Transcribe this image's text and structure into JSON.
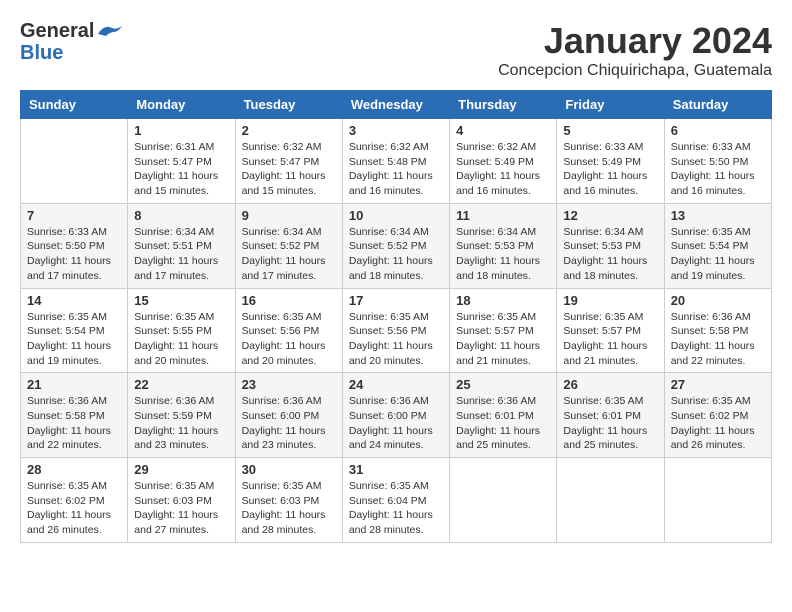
{
  "header": {
    "logo_line1": "General",
    "logo_line2": "Blue",
    "month_title": "January 2024",
    "location": "Concepcion Chiquirichapa, Guatemala"
  },
  "days_of_week": [
    "Sunday",
    "Monday",
    "Tuesday",
    "Wednesday",
    "Thursday",
    "Friday",
    "Saturday"
  ],
  "weeks": [
    [
      {
        "day": "",
        "sunrise": "",
        "sunset": "",
        "daylight": ""
      },
      {
        "day": "1",
        "sunrise": "Sunrise: 6:31 AM",
        "sunset": "Sunset: 5:47 PM",
        "daylight": "Daylight: 11 hours and 15 minutes."
      },
      {
        "day": "2",
        "sunrise": "Sunrise: 6:32 AM",
        "sunset": "Sunset: 5:47 PM",
        "daylight": "Daylight: 11 hours and 15 minutes."
      },
      {
        "day": "3",
        "sunrise": "Sunrise: 6:32 AM",
        "sunset": "Sunset: 5:48 PM",
        "daylight": "Daylight: 11 hours and 16 minutes."
      },
      {
        "day": "4",
        "sunrise": "Sunrise: 6:32 AM",
        "sunset": "Sunset: 5:49 PM",
        "daylight": "Daylight: 11 hours and 16 minutes."
      },
      {
        "day": "5",
        "sunrise": "Sunrise: 6:33 AM",
        "sunset": "Sunset: 5:49 PM",
        "daylight": "Daylight: 11 hours and 16 minutes."
      },
      {
        "day": "6",
        "sunrise": "Sunrise: 6:33 AM",
        "sunset": "Sunset: 5:50 PM",
        "daylight": "Daylight: 11 hours and 16 minutes."
      }
    ],
    [
      {
        "day": "7",
        "sunrise": "Sunrise: 6:33 AM",
        "sunset": "Sunset: 5:50 PM",
        "daylight": "Daylight: 11 hours and 17 minutes."
      },
      {
        "day": "8",
        "sunrise": "Sunrise: 6:34 AM",
        "sunset": "Sunset: 5:51 PM",
        "daylight": "Daylight: 11 hours and 17 minutes."
      },
      {
        "day": "9",
        "sunrise": "Sunrise: 6:34 AM",
        "sunset": "Sunset: 5:52 PM",
        "daylight": "Daylight: 11 hours and 17 minutes."
      },
      {
        "day": "10",
        "sunrise": "Sunrise: 6:34 AM",
        "sunset": "Sunset: 5:52 PM",
        "daylight": "Daylight: 11 hours and 18 minutes."
      },
      {
        "day": "11",
        "sunrise": "Sunrise: 6:34 AM",
        "sunset": "Sunset: 5:53 PM",
        "daylight": "Daylight: 11 hours and 18 minutes."
      },
      {
        "day": "12",
        "sunrise": "Sunrise: 6:34 AM",
        "sunset": "Sunset: 5:53 PM",
        "daylight": "Daylight: 11 hours and 18 minutes."
      },
      {
        "day": "13",
        "sunrise": "Sunrise: 6:35 AM",
        "sunset": "Sunset: 5:54 PM",
        "daylight": "Daylight: 11 hours and 19 minutes."
      }
    ],
    [
      {
        "day": "14",
        "sunrise": "Sunrise: 6:35 AM",
        "sunset": "Sunset: 5:54 PM",
        "daylight": "Daylight: 11 hours and 19 minutes."
      },
      {
        "day": "15",
        "sunrise": "Sunrise: 6:35 AM",
        "sunset": "Sunset: 5:55 PM",
        "daylight": "Daylight: 11 hours and 20 minutes."
      },
      {
        "day": "16",
        "sunrise": "Sunrise: 6:35 AM",
        "sunset": "Sunset: 5:56 PM",
        "daylight": "Daylight: 11 hours and 20 minutes."
      },
      {
        "day": "17",
        "sunrise": "Sunrise: 6:35 AM",
        "sunset": "Sunset: 5:56 PM",
        "daylight": "Daylight: 11 hours and 20 minutes."
      },
      {
        "day": "18",
        "sunrise": "Sunrise: 6:35 AM",
        "sunset": "Sunset: 5:57 PM",
        "daylight": "Daylight: 11 hours and 21 minutes."
      },
      {
        "day": "19",
        "sunrise": "Sunrise: 6:35 AM",
        "sunset": "Sunset: 5:57 PM",
        "daylight": "Daylight: 11 hours and 21 minutes."
      },
      {
        "day": "20",
        "sunrise": "Sunrise: 6:36 AM",
        "sunset": "Sunset: 5:58 PM",
        "daylight": "Daylight: 11 hours and 22 minutes."
      }
    ],
    [
      {
        "day": "21",
        "sunrise": "Sunrise: 6:36 AM",
        "sunset": "Sunset: 5:58 PM",
        "daylight": "Daylight: 11 hours and 22 minutes."
      },
      {
        "day": "22",
        "sunrise": "Sunrise: 6:36 AM",
        "sunset": "Sunset: 5:59 PM",
        "daylight": "Daylight: 11 hours and 23 minutes."
      },
      {
        "day": "23",
        "sunrise": "Sunrise: 6:36 AM",
        "sunset": "Sunset: 6:00 PM",
        "daylight": "Daylight: 11 hours and 23 minutes."
      },
      {
        "day": "24",
        "sunrise": "Sunrise: 6:36 AM",
        "sunset": "Sunset: 6:00 PM",
        "daylight": "Daylight: 11 hours and 24 minutes."
      },
      {
        "day": "25",
        "sunrise": "Sunrise: 6:36 AM",
        "sunset": "Sunset: 6:01 PM",
        "daylight": "Daylight: 11 hours and 25 minutes."
      },
      {
        "day": "26",
        "sunrise": "Sunrise: 6:35 AM",
        "sunset": "Sunset: 6:01 PM",
        "daylight": "Daylight: 11 hours and 25 minutes."
      },
      {
        "day": "27",
        "sunrise": "Sunrise: 6:35 AM",
        "sunset": "Sunset: 6:02 PM",
        "daylight": "Daylight: 11 hours and 26 minutes."
      }
    ],
    [
      {
        "day": "28",
        "sunrise": "Sunrise: 6:35 AM",
        "sunset": "Sunset: 6:02 PM",
        "daylight": "Daylight: 11 hours and 26 minutes."
      },
      {
        "day": "29",
        "sunrise": "Sunrise: 6:35 AM",
        "sunset": "Sunset: 6:03 PM",
        "daylight": "Daylight: 11 hours and 27 minutes."
      },
      {
        "day": "30",
        "sunrise": "Sunrise: 6:35 AM",
        "sunset": "Sunset: 6:03 PM",
        "daylight": "Daylight: 11 hours and 28 minutes."
      },
      {
        "day": "31",
        "sunrise": "Sunrise: 6:35 AM",
        "sunset": "Sunset: 6:04 PM",
        "daylight": "Daylight: 11 hours and 28 minutes."
      },
      {
        "day": "",
        "sunrise": "",
        "sunset": "",
        "daylight": ""
      },
      {
        "day": "",
        "sunrise": "",
        "sunset": "",
        "daylight": ""
      },
      {
        "day": "",
        "sunrise": "",
        "sunset": "",
        "daylight": ""
      }
    ]
  ]
}
